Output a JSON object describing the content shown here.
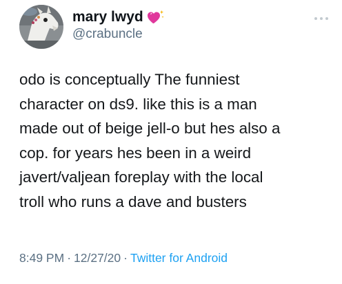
{
  "author": {
    "name": "mary lwyd",
    "handle": "@crabuncle"
  },
  "tweet": {
    "lines": [
      "odo is conceptually The funniest",
      "character on ds9. like this is a man",
      "made out of beige jell-o but hes also a",
      "cop. for years hes been in a weird",
      "javert/valjean foreplay with the local",
      "troll who runs a dave and busters"
    ]
  },
  "meta": {
    "time": "8:49 PM",
    "separator": "·",
    "date": "12/27/20",
    "source": "Twitter for Android"
  },
  "colors": {
    "text": "#14171a",
    "secondary": "#5b7083",
    "link": "#1da1f2",
    "heart": "#e0389c"
  },
  "icons": {
    "heart": "sparkling-heart-icon",
    "more": "more-dots-icon"
  }
}
